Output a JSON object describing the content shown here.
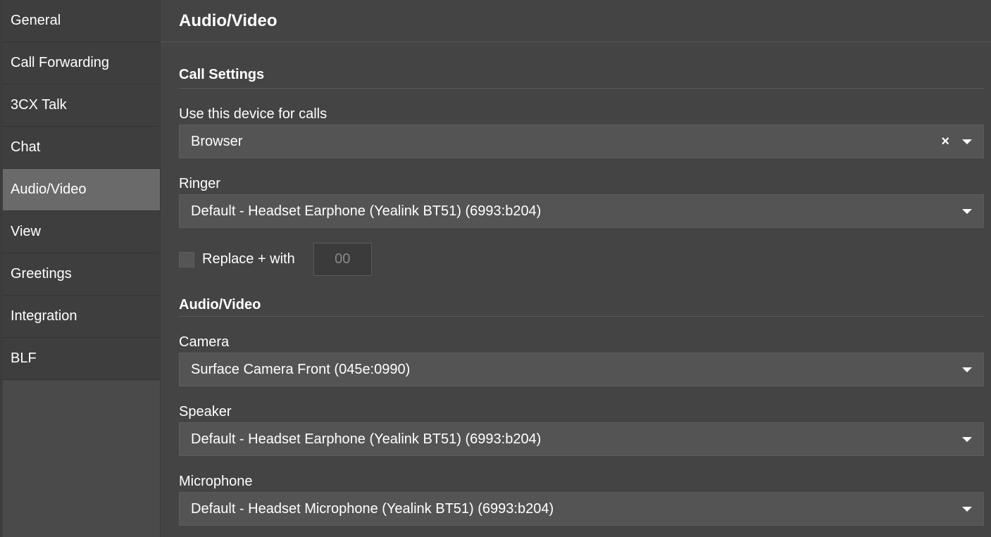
{
  "sidebar": {
    "items": [
      {
        "label": "General"
      },
      {
        "label": "Call Forwarding"
      },
      {
        "label": "3CX Talk"
      },
      {
        "label": "Chat"
      },
      {
        "label": "Audio/Video",
        "active": true
      },
      {
        "label": "View"
      },
      {
        "label": "Greetings"
      },
      {
        "label": "Integration"
      },
      {
        "label": "BLF"
      }
    ]
  },
  "header": {
    "title": "Audio/Video"
  },
  "call_settings": {
    "section_title": "Call Settings",
    "device_label": "Use this device for calls",
    "device_value": "Browser",
    "clear_icon": "×",
    "ringer_label": "Ringer",
    "ringer_value": "Default - Headset Earphone (Yealink BT51) (6993:b204)",
    "replace_label": "Replace + with",
    "replace_placeholder": "00",
    "replace_checked": false
  },
  "audio_video": {
    "section_title": "Audio/Video",
    "camera_label": "Camera",
    "camera_value": "Surface Camera Front (045e:0990)",
    "speaker_label": "Speaker",
    "speaker_value": "Default - Headset Earphone (Yealink BT51) (6993:b204)",
    "microphone_label": "Microphone",
    "microphone_value": "Default - Headset Microphone (Yealink BT51) (6993:b204)"
  },
  "icons": {
    "dropdown": "caret-down-icon",
    "clear": "close-icon"
  },
  "colors": {
    "background": "#444444",
    "sidebar_item": "#3e3e3e",
    "sidebar_active": "#6a6a6a",
    "select_bg": "#545454",
    "text": "#ffffff"
  }
}
